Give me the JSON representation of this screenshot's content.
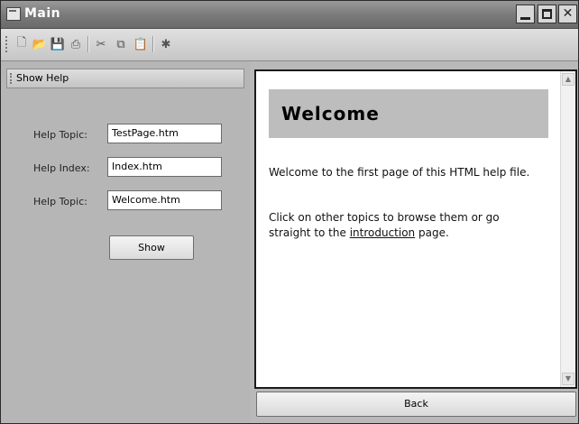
{
  "window": {
    "title": "Main",
    "controls": [
      "minimize-icon",
      "maximize-icon",
      "close-icon"
    ]
  },
  "toolbar": {
    "buttons": [
      {
        "icon": "new-file-icon",
        "glyph": "🗋"
      },
      {
        "icon": "open-folder-icon",
        "glyph": "📂"
      },
      {
        "icon": "save-icon",
        "glyph": "💾"
      },
      {
        "icon": "print-icon",
        "glyph": "⎙"
      },
      {
        "icon": "cut-icon",
        "glyph": "✂"
      },
      {
        "icon": "copy-icon",
        "glyph": "⧉"
      },
      {
        "icon": "paste-icon",
        "glyph": "📋"
      },
      {
        "icon": "help-icon",
        "glyph": "✱"
      }
    ]
  },
  "left_panel": {
    "header": "Show Help",
    "fields": [
      {
        "label": "Help Topic:",
        "value": "TestPage.htm"
      },
      {
        "label": "Help Index:",
        "value": "Index.htm"
      },
      {
        "label": "Help Topic:",
        "value": "Welcome.htm"
      }
    ],
    "show_button": "Show"
  },
  "viewer": {
    "welcome_title": "Welcome",
    "para1": "Welcome to the first page of this HTML help file.",
    "para2_before": "Click on other topics to browse them or go straight to the ",
    "para2_link": "introduction",
    "para2_after": " page."
  },
  "bottom_button": "Back"
}
